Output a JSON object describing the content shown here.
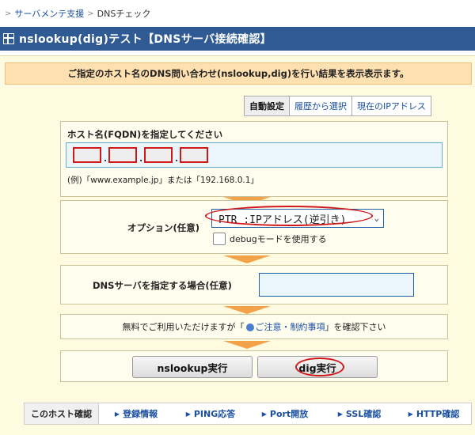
{
  "breadcrumb": {
    "items": [
      "サーバメンテ支援",
      "DNSチェック"
    ]
  },
  "title": "nslookup(dig)テスト【DNSサーバ接続確認】",
  "banner": "ご指定のホスト名のDNS問い合わせ(nslookup,dig)を行い結果を表示表示ます。",
  "tabs": [
    {
      "label": "自動設定",
      "active": true
    },
    {
      "label": "履歴から選択",
      "active": false
    },
    {
      "label": "現在のIPアドレス",
      "active": false
    }
  ],
  "host": {
    "label": "ホスト名(FQDN)を指定してください",
    "example": "(例)「www.example.jp」または「192.168.0.1」"
  },
  "option": {
    "label": "オプション(任意)",
    "selected": "PTR   :IPアドレス(逆引き)",
    "debug_label": "debugモードを使用する"
  },
  "dns": {
    "label": "DNSサーバを指定する場合(任意)",
    "value": ""
  },
  "notice": {
    "before": "無料でご利用いただけますが「",
    "link": "ご注意・制約事項",
    "after": "」を確認下さい"
  },
  "buttons": {
    "nslookup": "nslookup実行",
    "dig": "dig実行"
  },
  "bottom_nav": {
    "head": "このホスト確認",
    "items": [
      "登録情報",
      "PING応答",
      "Port開放",
      "SSL確認",
      "HTTP確認"
    ]
  },
  "colors": {
    "titlebar": "#2f5a93",
    "panel": "#fffbe0",
    "banner": "#ffe0b0",
    "arrow": "#f4a24a",
    "highlight": "#d01818"
  }
}
